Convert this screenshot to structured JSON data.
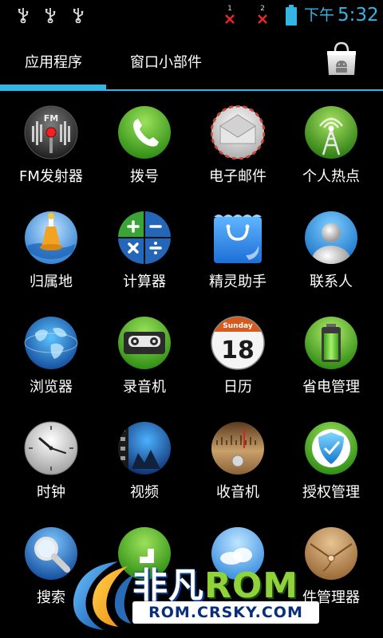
{
  "status_bar": {
    "sim1_label": "1",
    "sim2_label": "2",
    "ampm": "下午",
    "time": "5:32",
    "accent_color": "#35b5e5",
    "no_signal_color": "#e5262a"
  },
  "tabs": {
    "apps_label": "应用程序",
    "widgets_label": "窗口小部件",
    "active": "应用程序",
    "store_icon": "play-store-icon"
  },
  "apps": [
    {
      "label": "FM发射器",
      "icon": "fm-transmitter-icon"
    },
    {
      "label": "拨号",
      "icon": "phone-icon"
    },
    {
      "label": "电子邮件",
      "icon": "email-icon"
    },
    {
      "label": "个人热点",
      "icon": "hotspot-tower-icon"
    },
    {
      "label": "归属地",
      "icon": "location-buoy-icon"
    },
    {
      "label": "计算器",
      "icon": "calculator-icon"
    },
    {
      "label": "精灵助手",
      "icon": "shopping-bag-icon"
    },
    {
      "label": "联系人",
      "icon": "contact-person-icon"
    },
    {
      "label": "浏览器",
      "icon": "globe-icon"
    },
    {
      "label": "录音机",
      "icon": "cassette-icon"
    },
    {
      "label": "日历",
      "icon": "calendar-icon",
      "calendar_day": "Sunday",
      "calendar_date": "18"
    },
    {
      "label": "省电管理",
      "icon": "battery-icon"
    },
    {
      "label": "时钟",
      "icon": "clock-icon"
    },
    {
      "label": "视频",
      "icon": "video-film-icon"
    },
    {
      "label": "收音机",
      "icon": "radio-dial-icon"
    },
    {
      "label": "授权管理",
      "icon": "shield-icon"
    },
    {
      "label": "搜索",
      "icon": "search-icon"
    },
    {
      "label": "",
      "icon": "download-arrow-icon"
    },
    {
      "label": "",
      "icon": "weather-sky-icon"
    },
    {
      "label": "件管理器",
      "icon": "file-envelope-icon"
    }
  ],
  "watermark": {
    "title_cn": "非凡",
    "title_en": "ROM",
    "url": "ROM.CRSKY.COM"
  }
}
